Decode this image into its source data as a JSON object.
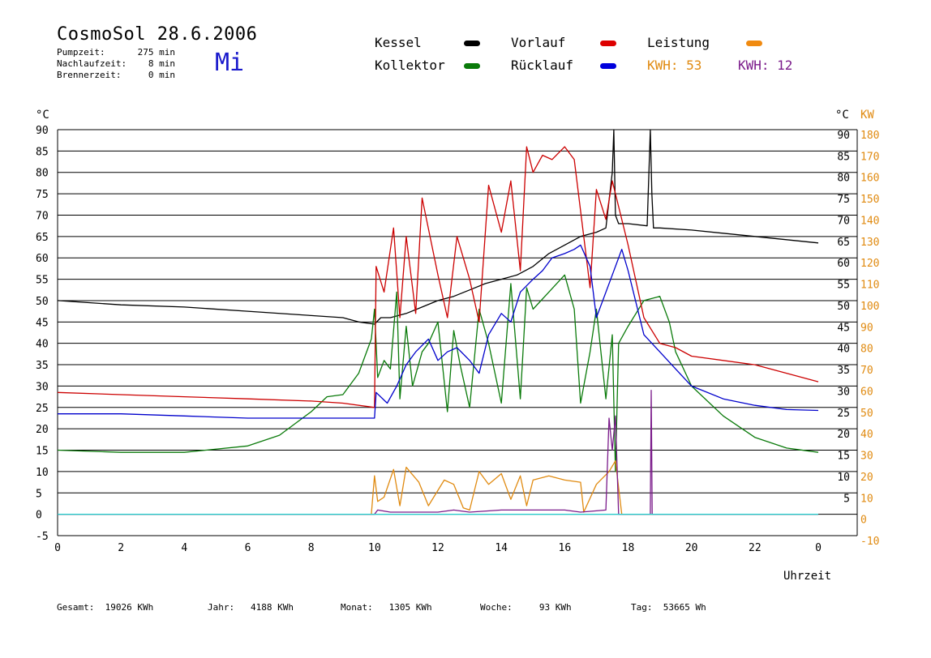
{
  "header": {
    "title": "CosmoSol 28.6.2006",
    "pumpzeit_label": "Pumpzeit:",
    "pumpzeit_value": "275 min",
    "nachlaufzeit_label": "Nachlaufzeit:",
    "nachlaufzeit_value": "8 min",
    "brennerzeit_label": "Brennerzeit:",
    "brennerzeit_value": "0 min",
    "weekday": "Mi"
  },
  "legend": {
    "kessel": "Kessel",
    "kollektor": "Kollektor",
    "vorlauf": "Vorlauf",
    "ruecklauf": "Rücklauf",
    "leistung": "Leistung",
    "kwh1_label": "KWH:",
    "kwh1_value": "53",
    "kwh2_label": "KWH:",
    "kwh2_value": "12",
    "colors": {
      "kessel": "#000000",
      "kollektor": "#0a7a0a",
      "vorlauf": "#cc0000",
      "ruecklauf": "#0000cc",
      "leistung": "#e08a10",
      "kwh2": "#7a1a8a",
      "baseline": "#20d0d0"
    }
  },
  "axes": {
    "y_left_unit": "°C",
    "y_right_unit_c": "°C",
    "y_right_unit_kw": "KW",
    "x_label": "Uhrzeit"
  },
  "footer": {
    "gesamt_label": "Gesamt:",
    "gesamt_value": "19026 KWh",
    "jahr_label": "Jahr:",
    "jahr_value": "4188 KWh",
    "monat_label": "Monat:",
    "monat_value": "1305 KWh",
    "woche_label": "Woche:",
    "woche_value": "93 KWh",
    "tag_label": "Tag:",
    "tag_value": "53665 Wh"
  },
  "chart_data": {
    "type": "line",
    "xlabel": "Uhrzeit",
    "ylabel": "°C",
    "xlim": [
      0,
      24
    ],
    "ylim": [
      -5,
      90
    ],
    "y2lim": [
      -10,
      180
    ],
    "grid": true,
    "x_ticks": [
      0,
      2,
      4,
      6,
      8,
      10,
      12,
      14,
      16,
      18,
      20,
      22,
      0
    ],
    "y_ticks_left": [
      -5,
      0,
      5,
      10,
      15,
      20,
      25,
      30,
      35,
      40,
      45,
      50,
      55,
      60,
      65,
      70,
      75,
      80,
      85,
      90
    ],
    "y_ticks_right_c": [
      5,
      10,
      15,
      20,
      25,
      30,
      35,
      40,
      45,
      50,
      55,
      60,
      65,
      70,
      75,
      80,
      85,
      90
    ],
    "y_ticks_right_kw": [
      -10,
      0,
      10,
      20,
      30,
      40,
      50,
      60,
      70,
      80,
      90,
      100,
      110,
      120,
      130,
      140,
      150,
      160,
      170,
      180
    ],
    "series": [
      {
        "name": "Kessel",
        "color": "#000000",
        "x": [
          0,
          2,
          4,
          6,
          8,
          9,
          9.5,
          10,
          10.2,
          10.5,
          11,
          11.5,
          12,
          12.5,
          13,
          13.5,
          14,
          14.5,
          15,
          15.5,
          16,
          16.5,
          17,
          17.3,
          17.5,
          17.55,
          17.6,
          17.7,
          18,
          18.6,
          18.7,
          18.75,
          18.8,
          19,
          20,
          22,
          24
        ],
        "y": [
          50,
          49,
          48.5,
          47.5,
          46.5,
          46,
          45,
          44.5,
          46,
          46,
          47,
          48.5,
          50,
          51,
          52.5,
          54,
          55,
          56,
          58,
          61,
          63,
          65,
          66,
          67,
          80,
          90,
          70,
          68,
          68,
          67.5,
          90,
          75,
          67,
          67,
          66.5,
          65,
          63.5
        ]
      },
      {
        "name": "Kollektor",
        "color": "#0a7a0a",
        "x": [
          0,
          2,
          4,
          6,
          7,
          8,
          8.5,
          9,
          9.5,
          9.9,
          10,
          10.1,
          10.3,
          10.5,
          10.7,
          10.8,
          11,
          11.2,
          11.5,
          11.7,
          12,
          12.3,
          12.5,
          12.7,
          13,
          13.3,
          13.6,
          14,
          14.3,
          14.6,
          14.8,
          15,
          15.5,
          16,
          16.3,
          16.5,
          16.8,
          17,
          17.3,
          17.5,
          17.6,
          17.7,
          18,
          18.5,
          19,
          19.3,
          19.5,
          20,
          21,
          22,
          23,
          24
        ],
        "y": [
          15,
          14.5,
          14.5,
          16,
          18.5,
          24,
          27.5,
          28,
          33,
          41,
          48,
          32,
          36,
          34,
          52,
          27,
          44,
          30,
          38,
          40,
          45,
          24,
          43,
          35,
          25,
          48,
          40,
          26,
          54,
          27,
          53,
          48,
          52,
          56,
          48,
          26,
          38,
          48,
          27,
          42,
          10,
          40,
          44,
          50,
          51,
          45,
          38,
          30,
          23,
          18,
          15.5,
          14.5
        ]
      },
      {
        "name": "Vorlauf",
        "color": "#cc0000",
        "x": [
          0,
          2,
          4,
          6,
          8,
          9,
          10,
          10.05,
          10.3,
          10.6,
          10.8,
          11,
          11.3,
          11.5,
          12,
          12.3,
          12.6,
          13,
          13.3,
          13.6,
          14,
          14.3,
          14.6,
          14.8,
          15,
          15.3,
          15.6,
          16,
          16.3,
          16.8,
          17,
          17.3,
          17.5,
          18,
          18.5,
          19,
          19.5,
          20,
          22,
          24
        ],
        "y": [
          28.5,
          28,
          27.5,
          27,
          26.5,
          26,
          25,
          58,
          52,
          67,
          46,
          65,
          47,
          74,
          56,
          46,
          65,
          55,
          45,
          77,
          66,
          78,
          57,
          86,
          80,
          84,
          83,
          86,
          83,
          53,
          76,
          69,
          78,
          63,
          46,
          40,
          39,
          37,
          35,
          31
        ]
      },
      {
        "name": "Rücklauf",
        "color": "#0000cc",
        "x": [
          0,
          2,
          4,
          6,
          8,
          10,
          10.05,
          10.4,
          10.7,
          11,
          11.3,
          11.7,
          12,
          12.3,
          12.6,
          13,
          13.3,
          13.6,
          14,
          14.3,
          14.6,
          15,
          15.3,
          15.6,
          16,
          16.3,
          16.5,
          16.8,
          17,
          17.5,
          17.8,
          18,
          18.5,
          19,
          19.5,
          20,
          21,
          22,
          23,
          24
        ],
        "y": [
          23.5,
          23.5,
          23,
          22.5,
          22.5,
          22.5,
          28.5,
          26,
          30,
          35,
          38,
          41,
          36,
          38,
          39,
          36,
          33,
          42,
          47,
          45,
          52,
          55,
          57,
          60,
          61,
          62,
          63,
          58,
          46,
          56,
          62,
          57,
          42,
          38,
          34,
          30,
          27,
          25.5,
          24.5,
          24.3
        ]
      },
      {
        "name": "Leistung",
        "color": "#e08a10",
        "axis": "right_kw",
        "x": [
          0,
          9.9,
          10,
          10.1,
          10.3,
          10.6,
          10.8,
          11,
          11.4,
          11.7,
          12.2,
          12.5,
          12.8,
          13,
          13.3,
          13.6,
          14,
          14.3,
          14.6,
          14.8,
          15,
          15.5,
          16,
          16.5,
          16.6,
          17,
          17.4,
          17.6,
          17.8,
          24
        ],
        "y": [
          0,
          0,
          18,
          6,
          8,
          21,
          4,
          22,
          15,
          4,
          16,
          14,
          3,
          2,
          20,
          14,
          19,
          7,
          18,
          4,
          16,
          18,
          16,
          15,
          1,
          14,
          20,
          25,
          0,
          0
        ]
      },
      {
        "name": "KWH 12",
        "color": "#7a1a8a",
        "axis": "right_kw",
        "x": [
          0,
          10,
          10.1,
          10.5,
          11,
          12,
          12.5,
          13,
          14,
          15,
          16,
          16.5,
          17.3,
          17.4,
          17.5,
          17.6,
          17.7,
          18.7,
          18.73,
          18.76,
          19,
          24
        ],
        "y": [
          0,
          0,
          2,
          1,
          1,
          1,
          2,
          1,
          2,
          2,
          2,
          1,
          2,
          45,
          30,
          46,
          0,
          0,
          58,
          0,
          0,
          0
        ]
      },
      {
        "name": "Null",
        "color": "#20d0d0",
        "x": [
          0,
          24
        ],
        "y": [
          0,
          0
        ]
      }
    ]
  }
}
